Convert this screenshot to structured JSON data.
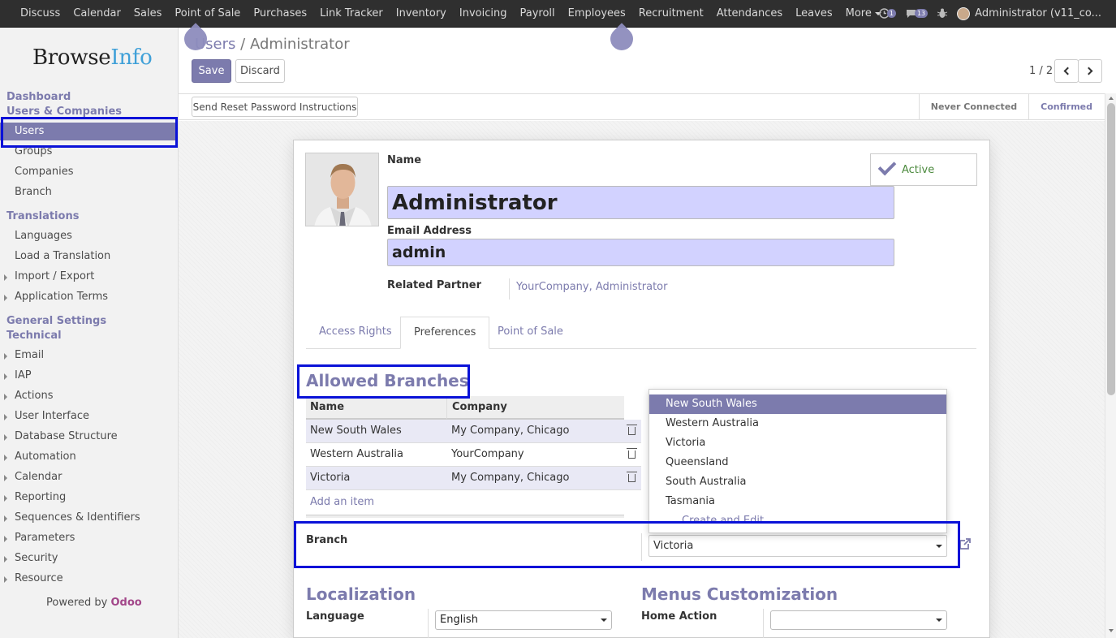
{
  "topbar": {
    "menu": [
      "Discuss",
      "Calendar",
      "Sales",
      "Point of Sale",
      "Purchases",
      "Link Tracker",
      "Inventory",
      "Invoicing",
      "Payroll",
      "Employees",
      "Recruitment",
      "Attendances",
      "Leaves",
      "More"
    ],
    "activity_count": "1",
    "messages_count": "13",
    "user": "Administrator (v11_co..."
  },
  "sidebar": {
    "logo_part1": "Browse",
    "logo_part2": "Info",
    "dashboard": "Dashboard",
    "users_companies": "Users & Companies",
    "users_items": [
      "Users",
      "Groups",
      "Companies",
      "Branch"
    ],
    "translations": "Translations",
    "translation_items": [
      "Languages",
      "Load a Translation",
      "Import / Export",
      "Application Terms"
    ],
    "general_settings": "General Settings",
    "technical": "Technical",
    "technical_items": [
      "Email",
      "IAP",
      "Actions",
      "User Interface",
      "Database Structure",
      "Automation",
      "Calendar",
      "Reporting",
      "Sequences & Identifiers",
      "Parameters",
      "Security",
      "Resource"
    ],
    "powered_by": "Powered by",
    "powered_brand": "Odoo"
  },
  "breadcrumb": {
    "parent": "Users",
    "sep": "/",
    "current": "Administrator"
  },
  "buttons": {
    "save": "Save",
    "discard": "Discard",
    "reset_password": "Send Reset Password Instructions"
  },
  "pager": "1 / 2",
  "status": {
    "stages": [
      "Never Connected",
      "Confirmed"
    ],
    "current": "Confirmed"
  },
  "form": {
    "name_label": "Name",
    "name_value": "Administrator",
    "email_label": "Email Address",
    "email_value": "admin",
    "partner_label": "Related Partner",
    "partner_value": "YourCompany, Administrator",
    "active_label": "Active",
    "tabs": [
      "Access Rights",
      "Preferences",
      "Point of Sale"
    ],
    "active_tab": "Preferences",
    "allowed_branches_title": "Allowed Branches",
    "table_headers": [
      "Name",
      "Company"
    ],
    "table_rows": [
      {
        "name": "New South Wales",
        "company": "My Company, Chicago"
      },
      {
        "name": "Western Australia",
        "company": "YourCompany"
      },
      {
        "name": "Victoria",
        "company": "My Company, Chicago"
      }
    ],
    "add_item": "Add an item",
    "branch_label": "Branch",
    "branch_value": "Victoria",
    "dropdown_options": [
      "New South Wales",
      "Western Australia",
      "Victoria",
      "Queensland",
      "South Australia",
      "Tasmania"
    ],
    "dropdown_create": "Create and Edit...",
    "localization_title": "Localization",
    "language_label": "Language",
    "language_value": "English",
    "menus_title": "Menus Customization",
    "home_action_label": "Home Action",
    "home_action_value": ""
  },
  "colors": {
    "accent": "#7c7bad",
    "highlight_box": "#0a12d8",
    "field_bg": "#d2d2ff"
  }
}
